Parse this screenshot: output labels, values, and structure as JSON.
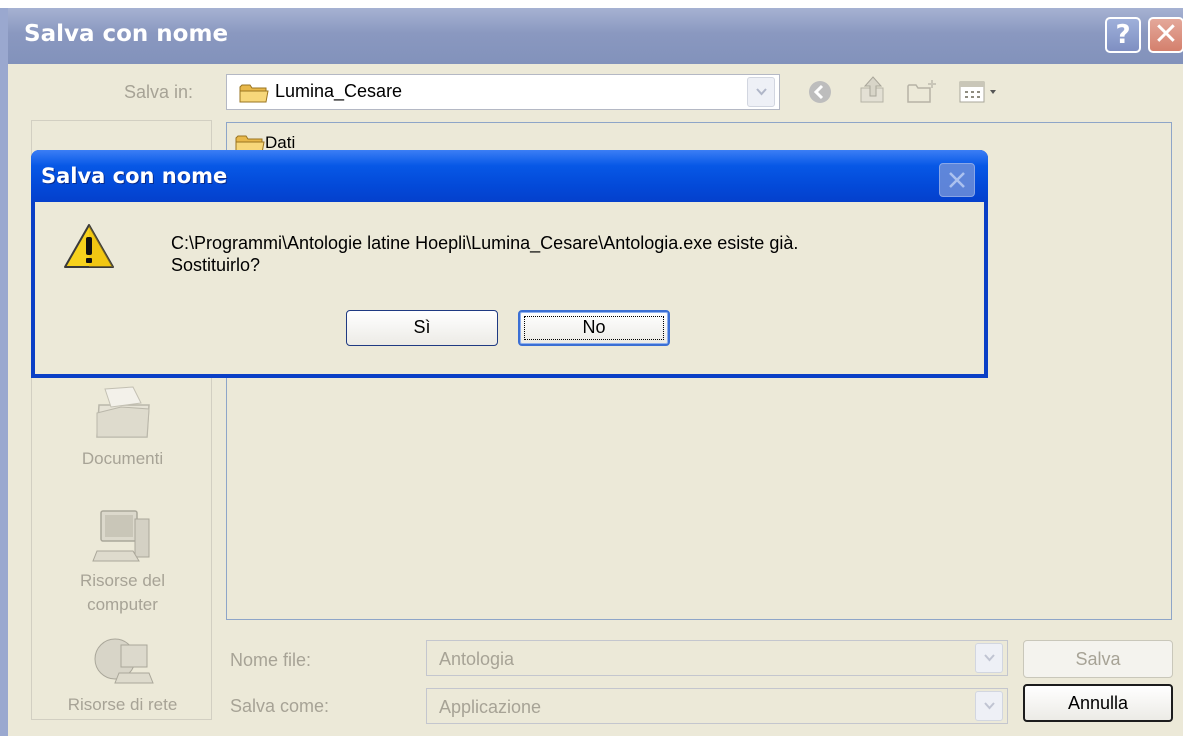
{
  "window": {
    "title": "Salva con nome",
    "help_glyph": "?",
    "close_glyph": "✕"
  },
  "save_in": {
    "label": "Salva in:",
    "value": "Lumina_Cesare",
    "icon": "folder-icon"
  },
  "toolbar": {
    "icons": [
      "back-icon",
      "up-folder-icon",
      "new-folder-icon",
      "view-menu-icon"
    ]
  },
  "places": [
    {
      "label": "Documenti",
      "icon": "documents-folder-icon"
    },
    {
      "label_line1": "Risorse del",
      "label_line2": "computer",
      "icon": "my-computer-icon"
    },
    {
      "label": "Risorse di rete",
      "icon": "network-icon"
    }
  ],
  "file_list": {
    "items": [
      {
        "name": "Dati",
        "icon": "folder-icon"
      }
    ]
  },
  "filename": {
    "label": "Nome file:",
    "value": "Antologia"
  },
  "save_as_type": {
    "label": "Salva come:",
    "value": "Applicazione"
  },
  "buttons": {
    "save": "Salva",
    "cancel": "Annulla"
  },
  "dialog": {
    "title": "Salva con nome",
    "message_line1": "C:\\Programmi\\Antologie latine Hoepli\\Lumina_Cesare\\Antologia.exe esiste già.",
    "message_line2": "Sostituirlo?",
    "yes": "Sì",
    "no": "No",
    "icon": "warning-icon",
    "close_glyph": "✕"
  },
  "colors": {
    "dialog_title": "#0758e6",
    "window_title_inactive": "#8a98c0",
    "face": "#ece9d8",
    "disabled_text": "#a7a396"
  }
}
